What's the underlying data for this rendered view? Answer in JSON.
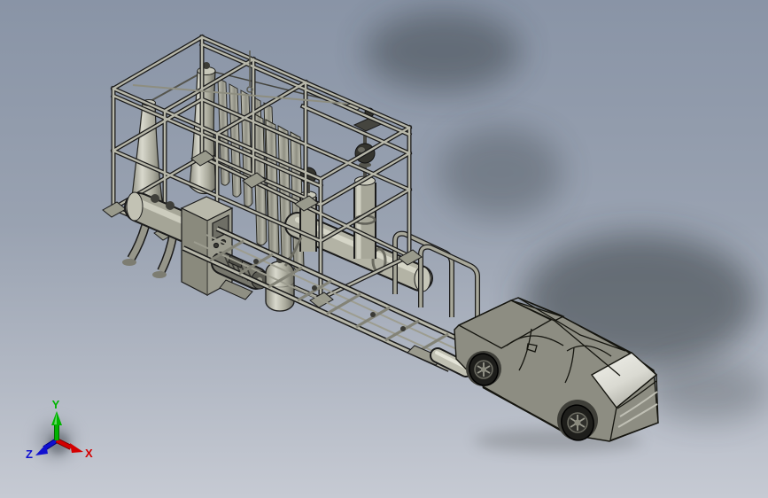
{
  "colors": {
    "bg_top": "#8994a6",
    "bg_mid": "#99a2b1",
    "bg_bottom": "#c6cad3",
    "edge": "#1b1b1b",
    "frame_fill": "#b7b7a9",
    "metal_light": "#d2d2c4",
    "metal_mid": "#a9a99b",
    "metal_dark": "#72726a",
    "car_body": "#8d8d82",
    "car_top": "#73736a",
    "car_roof": "#7f7f76",
    "car_glass": "#e6e6de",
    "wheel_dark": "#1e1e1b",
    "shadow": "#2c3034",
    "axis_x": "#d40000",
    "axis_y": "#00b400",
    "axis_z": "#1010d0"
  },
  "triad": {
    "axes": [
      {
        "id": "x",
        "label": "X",
        "color": "#d40000"
      },
      {
        "id": "y",
        "label": "Y",
        "color": "#00b400"
      },
      {
        "id": "z",
        "label": "Z",
        "color": "#1010d0"
      }
    ]
  }
}
